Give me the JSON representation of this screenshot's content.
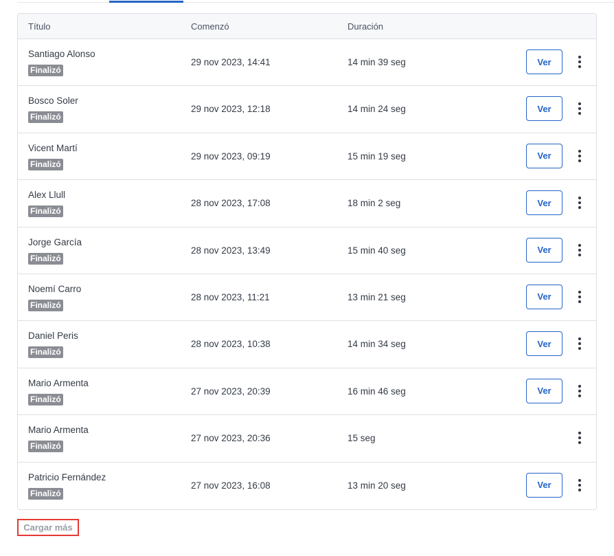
{
  "table": {
    "columns": {
      "title": "Título",
      "started": "Comenzó",
      "duration": "Duración"
    },
    "rows": [
      {
        "name": "Santiago Alonso",
        "status": "Finalizó",
        "started": "29 nov 2023, 14:41",
        "duration": "14 min 39 seg",
        "action": "Ver"
      },
      {
        "name": "Bosco Soler",
        "status": "Finalizó",
        "started": "29 nov 2023, 12:18",
        "duration": "14 min 24 seg",
        "action": "Ver"
      },
      {
        "name": "Vicent Martí",
        "status": "Finalizó",
        "started": "29 nov 2023, 09:19",
        "duration": "15 min 19 seg",
        "action": "Ver"
      },
      {
        "name": "Alex Llull",
        "status": "Finalizó",
        "started": "28 nov 2023, 17:08",
        "duration": "18 min 2 seg",
        "action": "Ver"
      },
      {
        "name": "Jorge García",
        "status": "Finalizó",
        "started": "28 nov 2023, 13:49",
        "duration": "15 min 40 seg",
        "action": "Ver"
      },
      {
        "name": "Noemí Carro",
        "status": "Finalizó",
        "started": "28 nov 2023, 11:21",
        "duration": "13 min 21 seg",
        "action": "Ver"
      },
      {
        "name": "Daniel Peris",
        "status": "Finalizó",
        "started": "28 nov 2023, 10:38",
        "duration": "14 min 34 seg",
        "action": "Ver"
      },
      {
        "name": "Mario Armenta",
        "status": "Finalizó",
        "started": "27 nov 2023, 20:39",
        "duration": "16 min 46 seg",
        "action": "Ver"
      },
      {
        "name": "Mario Armenta",
        "status": "Finalizó",
        "started": "27 nov 2023, 20:36",
        "duration": "15 seg",
        "action": null
      },
      {
        "name": "Patricio Fernández",
        "status": "Finalizó",
        "started": "27 nov 2023, 16:08",
        "duration": "13 min 20 seg",
        "action": "Ver"
      }
    ]
  },
  "footer": {
    "load_more_label": "Cargar más"
  },
  "icons": {
    "row_menu": "more-vertical-icon"
  },
  "colors": {
    "accent": "#2563c7",
    "badge": "#8a8d93",
    "highlight_border": "#e53935"
  }
}
